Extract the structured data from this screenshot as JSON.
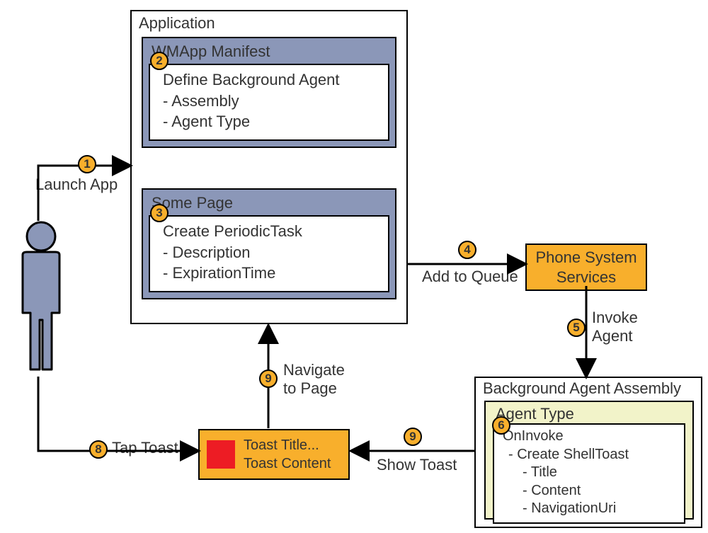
{
  "application": {
    "title": "Application",
    "manifest": {
      "title": "WMApp Manifest",
      "heading": "Define Background Agent",
      "items": [
        "- Assembly",
        "- Agent Type"
      ]
    },
    "page": {
      "title": "Some Page",
      "heading": "Create PeriodicTask",
      "items": [
        "- Description",
        "- ExpirationTime"
      ]
    }
  },
  "phoneServices": "Phone System\nServices",
  "backgroundAssembly": {
    "title": "Background Agent Assembly",
    "agentType": {
      "title": "Agent Type",
      "heading": "OnInvoke",
      "sub": "- Create ShellToast",
      "items": [
        "- Title",
        "- Content",
        "- NavigationUri"
      ]
    }
  },
  "toast": {
    "title": "Toast Title...",
    "content": "Toast Content"
  },
  "steps": {
    "s1": {
      "num": "1",
      "label": "Launch App"
    },
    "s2": {
      "num": "2"
    },
    "s3": {
      "num": "3"
    },
    "s4": {
      "num": "4",
      "label": "Add to Queue"
    },
    "s5": {
      "num": "5",
      "label": "Invoke\nAgent"
    },
    "s6": {
      "num": "6"
    },
    "s7a": {
      "num": "9",
      "label": "Show Toast"
    },
    "s8": {
      "num": "8",
      "label": "Tap Toast"
    },
    "s9": {
      "num": "9",
      "label": "Navigate\nto Page"
    }
  },
  "colors": {
    "blue": "#8b97b8",
    "orange": "#f8af2c",
    "yellow": "#f2f3c9",
    "red": "#ed1c24"
  }
}
